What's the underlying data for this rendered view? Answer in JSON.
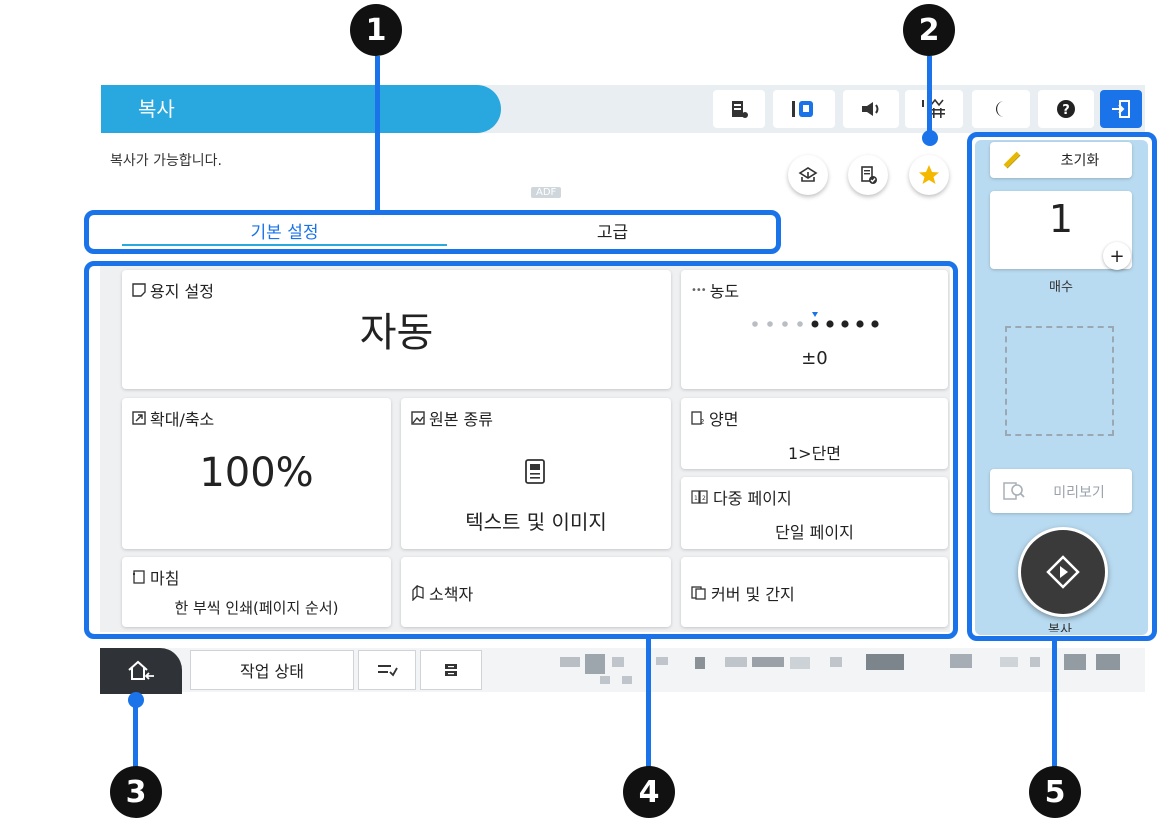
{
  "callouts": [
    "1",
    "2",
    "3",
    "4",
    "5"
  ],
  "header": {
    "title": "복사",
    "accent_color": "#29a8df",
    "status_icons": [
      "ink-status-icon",
      "maintenance-box-icon",
      "volume-icon",
      "fax-icon",
      "sleep-icon",
      "help-icon",
      "logout-icon"
    ]
  },
  "status_message": "복사가 가능합니다.",
  "adf_badge": "ADF",
  "quick_buttons": [
    "scan-preview-icon",
    "document-check-icon",
    "favorite-star-icon"
  ],
  "tabs": {
    "basic": "기본 설정",
    "advanced": "고급"
  },
  "settings": {
    "paper": {
      "label": "용지 설정",
      "value": "자동"
    },
    "density": {
      "label": "농도",
      "value": "±0",
      "level_steps": 9,
      "level_index": 4
    },
    "zoom": {
      "label": "확대/축소",
      "value": "100%"
    },
    "original_type": {
      "label": "원본 종류",
      "value": "텍스트 및 이미지"
    },
    "duplex": {
      "label": "양면",
      "value": "1>단면"
    },
    "multi_page": {
      "label": "다중 페이지",
      "value": "단일 페이지"
    },
    "finishing": {
      "label": "마침",
      "value": "한 부씩 인쇄(페이지 순서)"
    },
    "booklet": {
      "label": "소책자"
    },
    "cover": {
      "label": "커버 및 간지"
    }
  },
  "right_panel": {
    "reset_label": "초기화",
    "copies_value": "1",
    "plus_label": "+",
    "copies_caption": "매수",
    "preview_label": "미리보기",
    "start_caption": "복사"
  },
  "bottom": {
    "job_status_label": "작업 상태"
  }
}
